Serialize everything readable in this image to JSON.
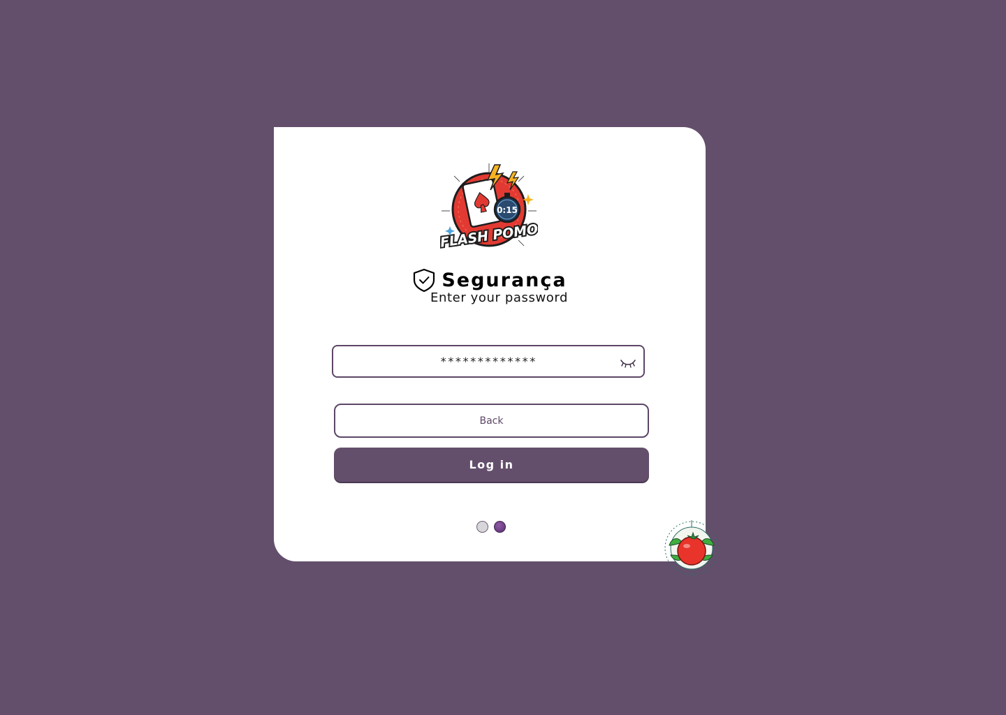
{
  "logo": {
    "text": "FLASH POMO",
    "timer_text": "0:15",
    "icon": "flash-pomo-logo"
  },
  "header": {
    "title": "Segurança",
    "subtitle": "Enter your password",
    "icon": "shield-check-icon"
  },
  "password": {
    "value": "*************",
    "toggle_icon": "eye-closed-icon"
  },
  "buttons": {
    "back_label": "Back",
    "login_label": "Log in"
  },
  "pagination": {
    "total": 2,
    "active_index": 1
  },
  "colors": {
    "background": "#634f6b",
    "accent": "#5d4667",
    "card": "#ffffff"
  },
  "mascot": {
    "icon": "tomato-icon"
  }
}
